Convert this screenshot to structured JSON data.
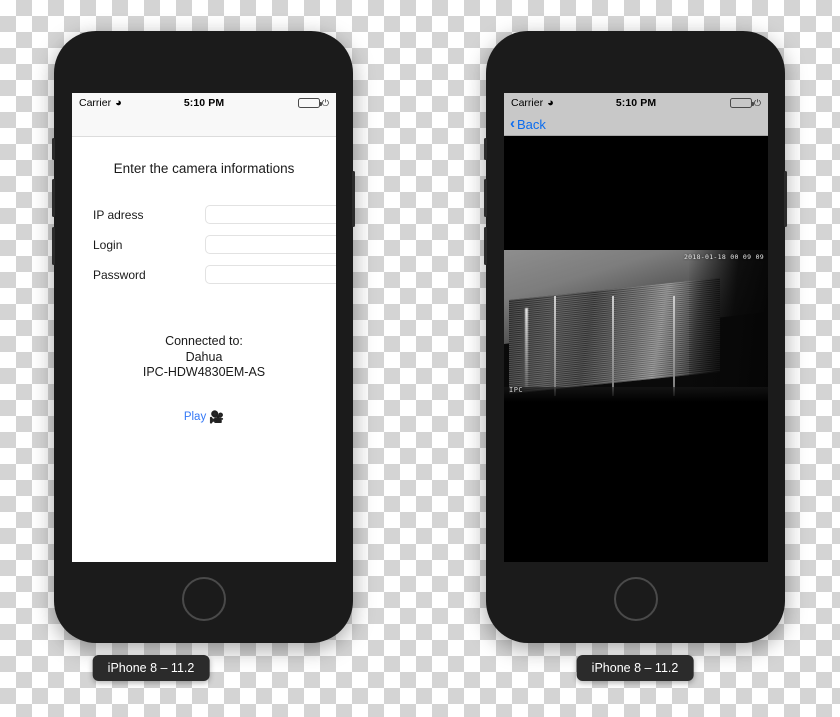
{
  "simulators": [
    {
      "caption": "iPhone 8 – 11.2",
      "status_bar": {
        "carrier": "Carrier",
        "wifi_icon": "wifi-icon",
        "time": "5:10 PM",
        "battery_icon": "battery-icon",
        "charging_icon": "charging-bolt-icon"
      },
      "screen": {
        "title": "Enter the camera informations",
        "fields": [
          {
            "label": "IP adress",
            "value": "",
            "placeholder": ""
          },
          {
            "label": "Login",
            "value": "",
            "placeholder": ""
          },
          {
            "label": "Password",
            "value": "",
            "placeholder": ""
          }
        ],
        "connected": {
          "heading": "Connected to:",
          "brand": "Dahua",
          "model": "IPC-HDW4830EM-AS"
        },
        "play": {
          "label": "Play",
          "icon": "🎥"
        }
      }
    },
    {
      "caption": "iPhone 8 – 11.2",
      "status_bar": {
        "carrier": "Carrier",
        "wifi_icon": "wifi-icon",
        "time": "5:10 PM",
        "battery_icon": "battery-icon",
        "charging_icon": "charging-bolt-icon"
      },
      "screen": {
        "back_button": "Back",
        "back_chevron": "‹",
        "video": {
          "timestamp": "2018-01-18 00 09 09",
          "watermark": "IPC"
        }
      }
    }
  ],
  "colors": {
    "accent_blue": "#3478f6",
    "nav_blue": "#0a6cf0",
    "battery_green": "#4cd964",
    "device_body": "#1b1b1b",
    "caption_bg": "#2b2b2b"
  }
}
